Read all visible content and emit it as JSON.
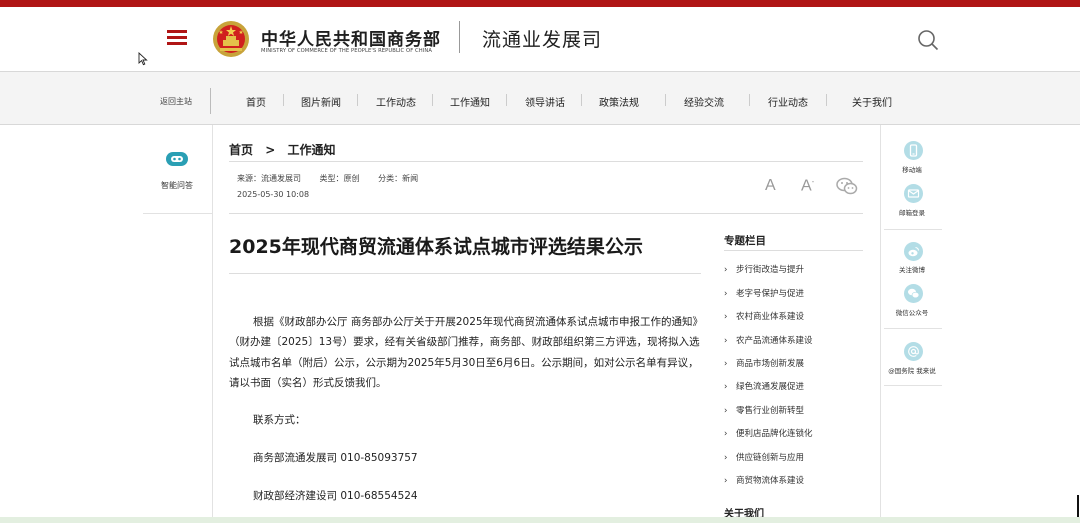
{
  "header": {
    "ministry_cn": "中华人民共和国商务部",
    "ministry_en": "MINISTRY OF COMMERCE OF THE PEOPLE'S REPUBLIC OF CHINA",
    "department": "流通业发展司",
    "accent_color": "#b01515",
    "menu_icon": "hamburger-menu-icon",
    "search_icon": "search-icon"
  },
  "nav": {
    "back_label": "返回主站",
    "items": [
      "首页",
      "图片新闻",
      "工作动态",
      "工作通知",
      "领导讲话",
      "政策法规",
      "经验交流",
      "行业动态",
      "关于我们"
    ]
  },
  "left_sidebar": {
    "assistant_label": "智能问答",
    "assistant_icon": "chatbot-icon"
  },
  "breadcrumb": {
    "home": "首页",
    "separator": ">",
    "current": "工作通知"
  },
  "meta": {
    "source": "来源：流通发展司",
    "type": "类型：原创",
    "category": "分类：新闻",
    "date": "2025-05-30 10:08",
    "font_large_label": "A",
    "font_small_label": "A",
    "font_small_sup": "-",
    "share_icon": "wechat-icon"
  },
  "article": {
    "title": "2025年现代商贸流通体系试点城市评选结果公示",
    "paragraph": "根据《财政部办公厅 商务部办公厅关于开展2025年现代商贸流通体系试点城市申报工作的通知》（财办建〔2025〕13号）要求，经有关省级部门推荐，商务部、财政部组织第三方评选，现将拟入选试点城市名单（附后）公示，公示期为2025年5月30日至6月6日。公示期间，如对公示名单有异议，请以书面（实名）形式反馈我们。",
    "contact_heading": "联系方式：",
    "contacts": [
      "商务部流通发展司 010-85093757",
      "财政部经济建设司 010-68554524"
    ]
  },
  "topics": {
    "title": "专题栏目",
    "arrow": "›",
    "items": [
      "步行街改造与提升",
      "老字号保护与促进",
      "农村商业体系建设",
      "农产品流通体系建设",
      "商品市场创新发展",
      "绿色流通发展促进",
      "零售行业创新转型",
      "便利店品牌化连锁化",
      "供应链创新与应用",
      "商贸物流体系建设"
    ],
    "about_title": "关于我们"
  },
  "right_sidebar": {
    "items": [
      {
        "label": "移动端",
        "icon": "mobile-icon"
      },
      {
        "label": "邮箱登录",
        "icon": "mail-icon"
      },
      {
        "label": "关注微博",
        "icon": "weibo-icon"
      },
      {
        "label": "微信公众号",
        "icon": "wechat-icon"
      },
      {
        "label": "@国务院 我来说",
        "icon": "at-icon"
      }
    ]
  }
}
